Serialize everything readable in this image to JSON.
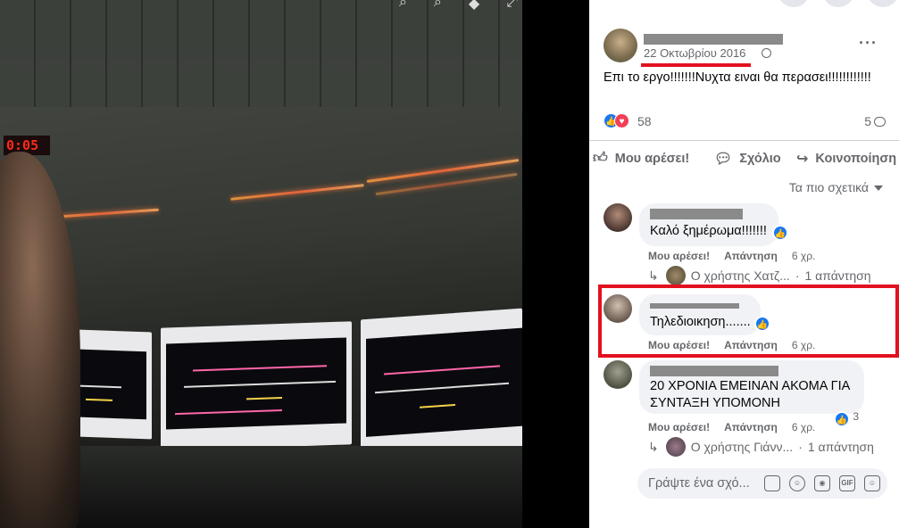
{
  "post": {
    "date": "22 Οκτωβρίου 2016",
    "text": "Επι το εργο!!!!!!!Νυχτα ειναι θα περασει!!!!!!!!!!!!",
    "reaction_count": "58",
    "comment_count": "5"
  },
  "photo": {
    "clock": "0:05"
  },
  "actions": {
    "like": "Μου αρέσει!",
    "comment": "Σχόλιο",
    "share": "Κοινοποίηση"
  },
  "sort_label": "Τα πιο σχετικά",
  "comments": [
    {
      "text": "Καλό ξημέρωμα!!!!!!!",
      "like_label": "Μου αρέσει!",
      "reply_label": "Απάντηση",
      "ago": "6 χρ.",
      "reply_user": "Ο χρήστης Χατζ...",
      "reply_count": "1 απάντηση"
    },
    {
      "text": "Τηλεδιοικηση.......",
      "like_label": "Μου αρέσει!",
      "reply_label": "Απάντηση",
      "ago": "6 χρ."
    },
    {
      "text_line1": "20 ΧΡΟΝΙΑ ΕΜΕΙΝΑΝ ΑΚΟΜΑ ΓΙΑ",
      "text_line2": "ΣΥΝΤΑΞΗ ΥΠΟΜΟΝΗ",
      "like_label": "Μου αρέσει!",
      "reply_label": "Απάντηση",
      "ago": "6 χρ.",
      "likes": "3",
      "reply_user": "Ο χρήστης Γιάνν...",
      "reply_count": "1 απάντηση"
    }
  ],
  "composer": {
    "placeholder": "Γράψτε ένα σχό..."
  },
  "colors": {
    "facebook_blue": "#1877f2",
    "love_red": "#f33e58",
    "annotation_red": "#e3101f",
    "bubble_gray": "#f0f2f5",
    "secondary_text": "#65676b"
  }
}
